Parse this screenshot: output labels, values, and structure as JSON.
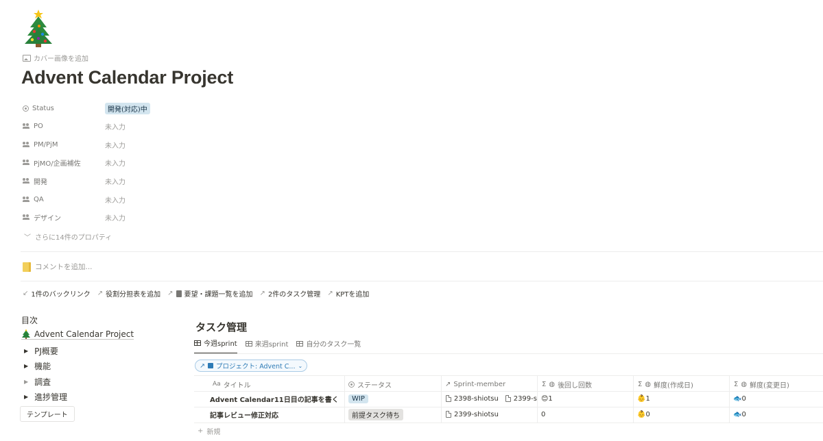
{
  "page": {
    "icon": "christmas-tree-icon",
    "add_cover": "カバー画像を追加",
    "title": "Advent Calendar Project"
  },
  "properties": [
    {
      "name": "Status",
      "icon": "circle-dot-icon",
      "value": "開発(対応)中"
    },
    {
      "name": "PO",
      "icon": "people-icon",
      "value": "未入力"
    },
    {
      "name": "PM/PjM",
      "icon": "people-icon",
      "value": "未入力"
    },
    {
      "name": "PjMO/企画補佐",
      "icon": "people-icon",
      "value": "未入力"
    },
    {
      "name": "開発",
      "icon": "people-icon",
      "value": "未入力"
    },
    {
      "name": "QA",
      "icon": "people-icon",
      "value": "未入力"
    },
    {
      "name": "デザイン",
      "icon": "people-icon",
      "value": "未入力"
    }
  ],
  "more_properties": "さらに14件のプロパティ",
  "comment_placeholder": "コメントを追加...",
  "links": {
    "backlinks": "1件のバックリンク",
    "roles": "役割分担表を追加",
    "requests": "要望・課題一覧を追加",
    "tasks": "2件のタスク管理",
    "kpt": "KPTを追加"
  },
  "toc": {
    "title": "目次",
    "project": "Advent Calendar Project",
    "items": [
      "PJ概要",
      "機能",
      "調査",
      "進捗管理"
    ],
    "template_button": "テンプレート"
  },
  "database": {
    "title": "タスク管理",
    "tabs": [
      "今週sprint",
      "来週sprint",
      "自分のタスク一覧"
    ],
    "filter": "プロジェクト: Advent C...",
    "columns": {
      "title": "タイトル",
      "title_prefix": "Aa",
      "status": "ステータス",
      "member": "Sprint-member",
      "postpone": "後回し回数",
      "fresh_created": "鮮度(作成日)",
      "fresh_updated": "鮮度(変更日)"
    },
    "rows": [
      {
        "title": "Advent Calendar11日目の記事を書く",
        "status": "WIP",
        "members": [
          "2398-shiotsu",
          "2399-s"
        ],
        "postpone": "😊1",
        "fresh_created": "👶1",
        "fresh_updated": "🐟0"
      },
      {
        "title": "記事レビュー修正対応",
        "status": "前提タスク待ち",
        "members": [
          "2399-shiotsu"
        ],
        "postpone": "0",
        "fresh_created": "👶0",
        "fresh_updated": "🐟0"
      }
    ],
    "new_label": "新規"
  },
  "colors": {
    "status_tag_bg": "#d3e5ef",
    "wait_tag_bg": "#e3e2e0",
    "filter_blue": "#2e7bb6",
    "text": "#37352f"
  }
}
